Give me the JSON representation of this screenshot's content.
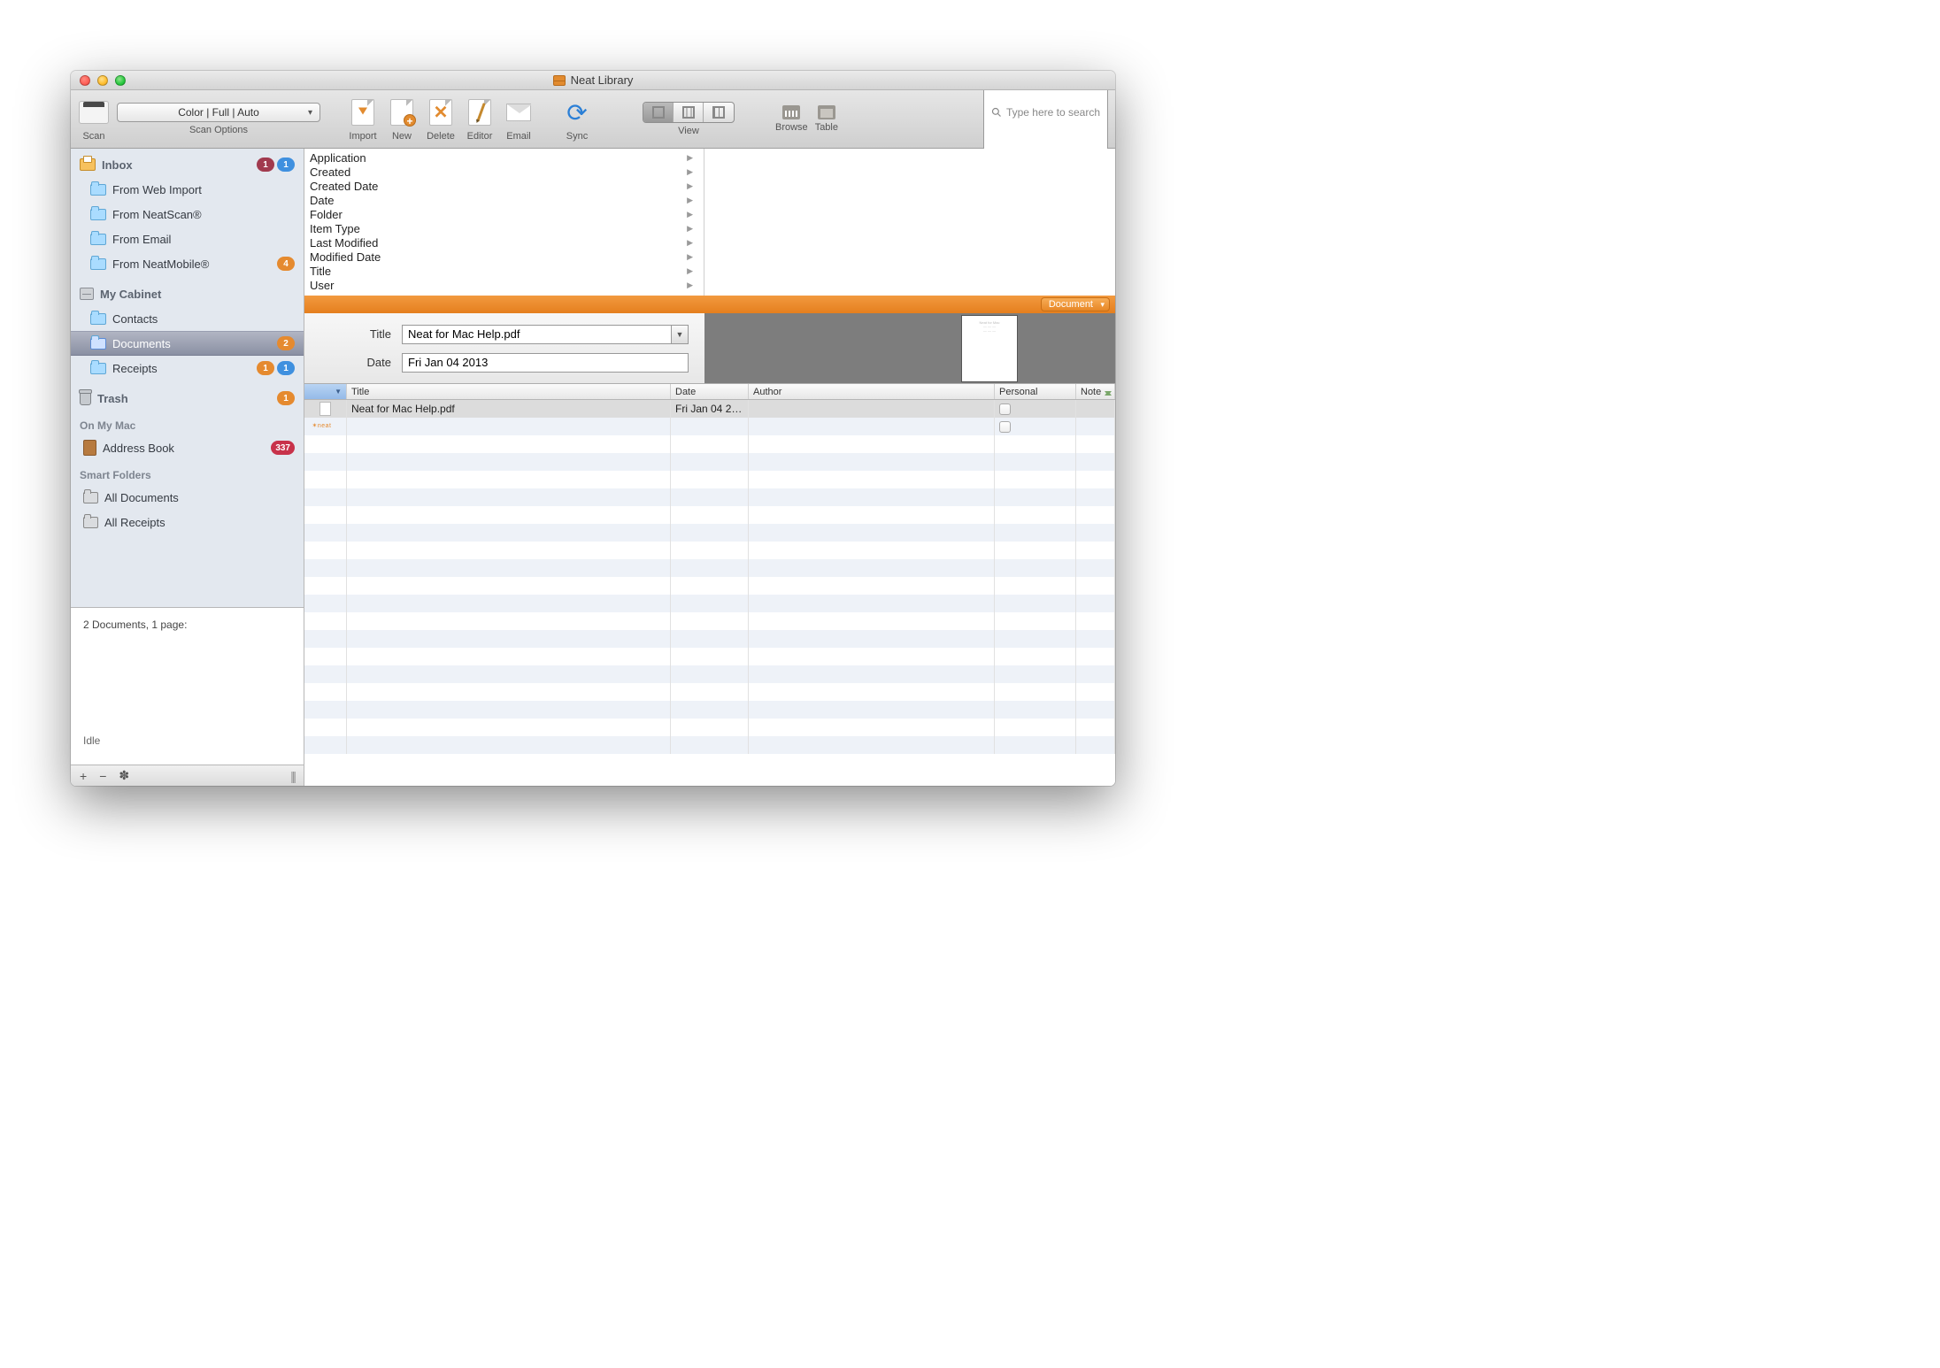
{
  "window_title": "Neat Library",
  "toolbar": {
    "scan_label": "Scan",
    "scan_options": "Color | Full | Auto",
    "scan_options_label": "Scan Options",
    "import": "Import",
    "new": "New",
    "delete": "Delete",
    "editor": "Editor",
    "email": "Email",
    "sync": "Sync",
    "view": "View",
    "browse": "Browse",
    "table": "Table",
    "search_label": "Search",
    "search_placeholder": "Type here to search"
  },
  "sidebar": {
    "inbox": {
      "label": "Inbox",
      "badge1": "1",
      "badge2": "1",
      "items": [
        {
          "label": "From Web Import"
        },
        {
          "label": "From NeatScan®"
        },
        {
          "label": "From Email"
        },
        {
          "label": "From NeatMobile®",
          "badge": "4",
          "badge_color": "orange"
        }
      ]
    },
    "cabinet": {
      "label": "My Cabinet",
      "items": [
        {
          "label": "Contacts"
        },
        {
          "label": "Documents",
          "badge": "2",
          "badge_color": "orange",
          "selected": true
        },
        {
          "label": "Receipts",
          "badge1": "1",
          "badge2": "1"
        }
      ]
    },
    "trash": {
      "label": "Trash",
      "badge": "1",
      "badge_color": "orange"
    },
    "onmymac": {
      "label": "On My Mac",
      "items": [
        {
          "label": "Address Book",
          "badge": "337",
          "badge_color": "red"
        }
      ]
    },
    "smart": {
      "label": "Smart Folders",
      "items": [
        {
          "label": "All Documents"
        },
        {
          "label": "All Receipts"
        }
      ]
    },
    "status_line": "2 Documents, 1 page:",
    "idle": "Idle"
  },
  "filters": [
    "Application",
    "Created",
    "Created Date",
    "Date",
    "Folder",
    "Item Type",
    "Last Modified",
    "Modified Date",
    "Title",
    "User"
  ],
  "orange_bar": {
    "dropdown_label": "Document"
  },
  "meta": {
    "title_label": "Title",
    "title_value": "Neat for Mac Help.pdf",
    "date_label": "Date",
    "date_value": "Fri Jan 04 2013"
  },
  "table": {
    "columns": {
      "title": "Title",
      "date": "Date",
      "author": "Author",
      "personal": "Personal",
      "note": "Note"
    },
    "rows": [
      {
        "thumb": "page",
        "title": "Neat for Mac Help.pdf",
        "date": "Fri Jan 04 2…",
        "author": "",
        "personal_checked": false
      },
      {
        "thumb": "neat",
        "title": "",
        "date": "",
        "author": "",
        "personal_checked": false
      }
    ]
  }
}
